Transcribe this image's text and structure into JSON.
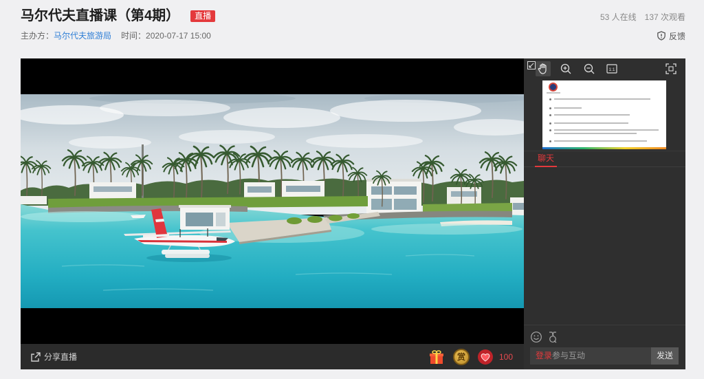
{
  "header": {
    "title": "马尔代夫直播课（第4期）",
    "live_badge": "直播",
    "organizer_label": "主办方：",
    "organizer_name": "马尔代夫旅游局",
    "time_label": "时间：",
    "time_value": "2020-07-17 15:00",
    "online_count": "53 人在线",
    "view_count": "137 次观看",
    "feedback_label": "反馈"
  },
  "player": {
    "share_label": "分享直播",
    "reward_label": "赏",
    "like_count": "100"
  },
  "doc_viewer": {
    "actual_size_label": "1:1"
  },
  "chat": {
    "tab_label": "聊天",
    "login_link": "登录",
    "input_prompt": "参与互动",
    "send_label": "发送"
  },
  "icons": {
    "feedback": "shield-icon",
    "share": "share-icon",
    "gift": "gift-icon",
    "reward": "reward-coin-icon",
    "like": "heart-icon",
    "doc_toolbar": [
      "shrink-icon",
      "hand-icon",
      "zoom-in-icon",
      "zoom-out-icon",
      "actual-size-icon",
      "fullscreen-icon"
    ],
    "chat_tools": [
      "emoji-icon",
      "medal-icon"
    ]
  },
  "colors": {
    "accent_red": "#e4393c",
    "link_blue": "#2f7fd6",
    "panel_bg": "#2f2f2f",
    "player_bar_bg": "#2b2b2b",
    "page_bg": "#f0f0f2"
  }
}
